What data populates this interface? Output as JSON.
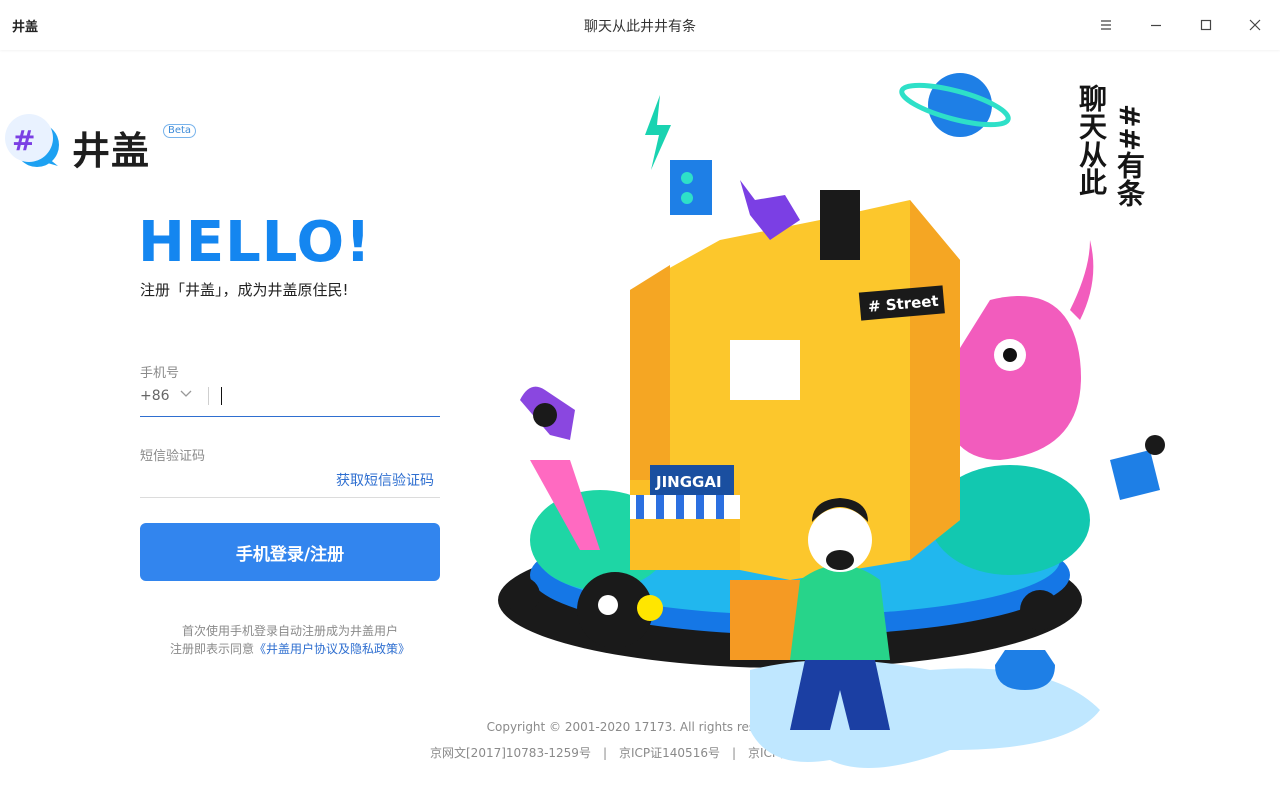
{
  "titlebar": {
    "app_name": "井盖",
    "window_title": "聊天从此井井有条",
    "buttons": [
      "menu-icon",
      "minimize-icon",
      "maximize-icon",
      "close-icon"
    ]
  },
  "logo": {
    "icon": "hash-bubble-logo",
    "text": "井盖",
    "badge": "Beta"
  },
  "hero": {
    "hello": "HELLO!",
    "subtitle": "注册「井盖」，成为井盖原住民!"
  },
  "form": {
    "phone_label": "手机号",
    "country_code": "+86",
    "phone_value": "",
    "sms_label": "短信验证码",
    "sms_value": "",
    "get_code_label": "获取短信验证码",
    "submit_label": "手机登录/注册"
  },
  "notes": {
    "line1": "首次使用手机登录自动注册成为井盖用户",
    "line2_prefix": "注册即表示同意",
    "agreement_link": "《井盖用户协议及隐私政策》"
  },
  "footer": {
    "copyright": "Copyright © 2001-2020 17173. All rights reserved.",
    "license1": "京网文[2017]10783-1259号",
    "license2": "京ICP证140516号",
    "license3": "京ICP备14014454号-1",
    "divider": "|"
  },
  "illustration": {
    "slogan_col1": "聊天从此",
    "slogan_col2": "##有条",
    "street_sign": "# Street",
    "shop_sign": "JINGGAI"
  },
  "colors": {
    "brand_blue": "#1486f0",
    "button_blue": "#3285ee",
    "link_blue": "#2f6fd0",
    "building_yellow": "#fcc72c",
    "pink": "#f25cbd"
  }
}
